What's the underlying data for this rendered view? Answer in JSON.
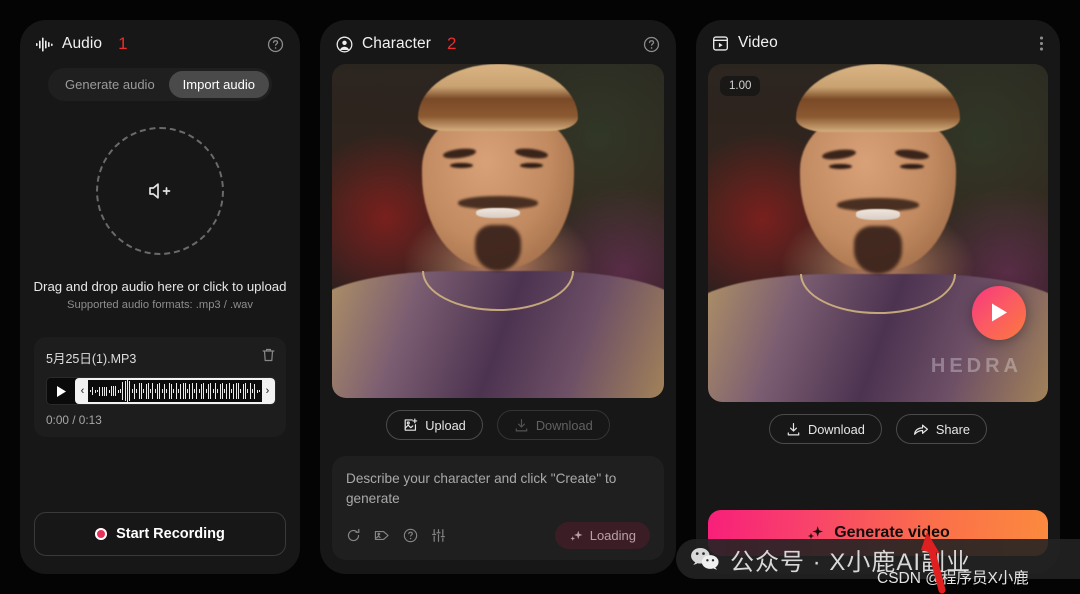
{
  "audio_panel": {
    "title": "Audio",
    "step": "1",
    "help_icon": "help-circle-icon",
    "title_icon": "waveform-icon",
    "tabs": [
      {
        "label": "Generate audio",
        "active": false
      },
      {
        "label": "Import audio",
        "active": true
      }
    ],
    "dropzone": {
      "icon": "volume-plus-icon",
      "main": "Drag and drop audio here or click to upload",
      "sub": "Supported audio formats: .mp3 / .wav"
    },
    "player": {
      "filename": "5月25日(1).MP3",
      "delete_icon": "trash-icon",
      "play_icon": "play-icon",
      "handle_left": "‹",
      "handle_right": "›",
      "timecode": "0:00 / 0:13",
      "current_time": "0:00",
      "duration": "0:13"
    },
    "record_button": {
      "label": "Start Recording",
      "icon": "record-dot-icon"
    }
  },
  "character_panel": {
    "title": "Character",
    "step": "2",
    "title_icon": "user-circle-icon",
    "help_icon": "help-circle-icon",
    "actions": [
      {
        "label": "Upload",
        "icon": "image-plus-icon",
        "disabled": false
      },
      {
        "label": "Download",
        "icon": "download-icon",
        "disabled": true
      }
    ],
    "prompt": {
      "placeholder": "Describe your character and click \"Create\" to generate",
      "value": "",
      "tools": [
        "refresh-icon",
        "tag-image-icon",
        "help-circle-icon",
        "sliders-icon"
      ],
      "submit_label": "Loading",
      "submit_icon": "sparkles-icon"
    }
  },
  "video_panel": {
    "title": "Video",
    "title_icon": "video-frame-icon",
    "menu_icon": "kebab-menu-icon",
    "duration_badge": "1.00",
    "play_icon": "play-circle-icon",
    "watermark": "HEDRA",
    "actions": [
      {
        "label": "Download",
        "icon": "download-icon"
      },
      {
        "label": "Share",
        "icon": "share-arrow-icon"
      }
    ],
    "generate_button": {
      "label": "Generate video",
      "icon": "sparkles-icon"
    }
  },
  "overlay_watermark": {
    "wechat_icon": "wechat-icon",
    "text": "公众号 · X小鹿AI副业",
    "csdn": "CSDN @程序员X小鹿"
  },
  "colors": {
    "accent_red": "#ef2b2b",
    "gradient_start": "#f81f7a",
    "gradient_end": "#fb8a3e",
    "panel_bg": "#171717",
    "page_bg": "#040404",
    "record_dot": "#e8325a"
  }
}
